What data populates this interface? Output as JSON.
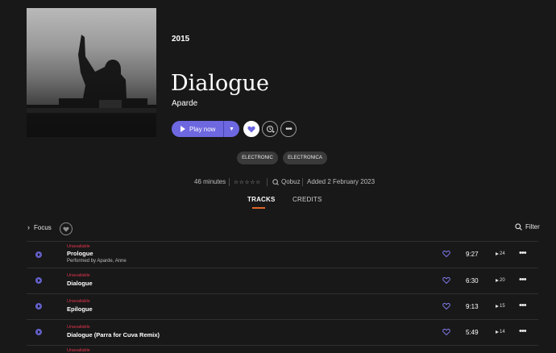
{
  "album": {
    "year": "2015",
    "title": "Dialogue",
    "artist": "Aparde",
    "play_label": "Play now",
    "genres": [
      "ELECTRONIC",
      "ELECTRONICA"
    ],
    "duration": "46 minutes",
    "rating_stars": "☆☆☆☆☆",
    "label": "Qobuz",
    "added": "Added 2 February 2023"
  },
  "tabs": {
    "tracks": "TRACKS",
    "credits": "CREDITS"
  },
  "toolbar": {
    "focus": "Focus",
    "filter": "Filter"
  },
  "tracks": [
    {
      "status": "Unavailable",
      "title": "Prologue",
      "performer": "Performed by Aparde, Anne",
      "duration": "9:27",
      "plays": "24"
    },
    {
      "status": "Unavailable",
      "title": "Dialogue",
      "performer": "",
      "duration": "6:30",
      "plays": "20"
    },
    {
      "status": "Unavailable",
      "title": "Epilogue",
      "performer": "",
      "duration": "9:13",
      "plays": "15"
    },
    {
      "status": "Unavailable",
      "title": "Dialogue (Parra for Cuva Remix)",
      "performer": "",
      "duration": "5:49",
      "plays": "14"
    },
    {
      "status": "Unavailable",
      "title": "",
      "performer": "",
      "duration": "",
      "plays": ""
    }
  ],
  "colors": {
    "accent": "#6d67e0",
    "tab_underline": "#e0672b",
    "unavailable": "#e0344e",
    "background": "#181818"
  },
  "icons": [
    "play-icon",
    "chevron-down-icon",
    "heart-icon",
    "add-to-playlist-icon",
    "more-icon",
    "qobuz-icon",
    "chevron-right-icon",
    "search-icon"
  ]
}
